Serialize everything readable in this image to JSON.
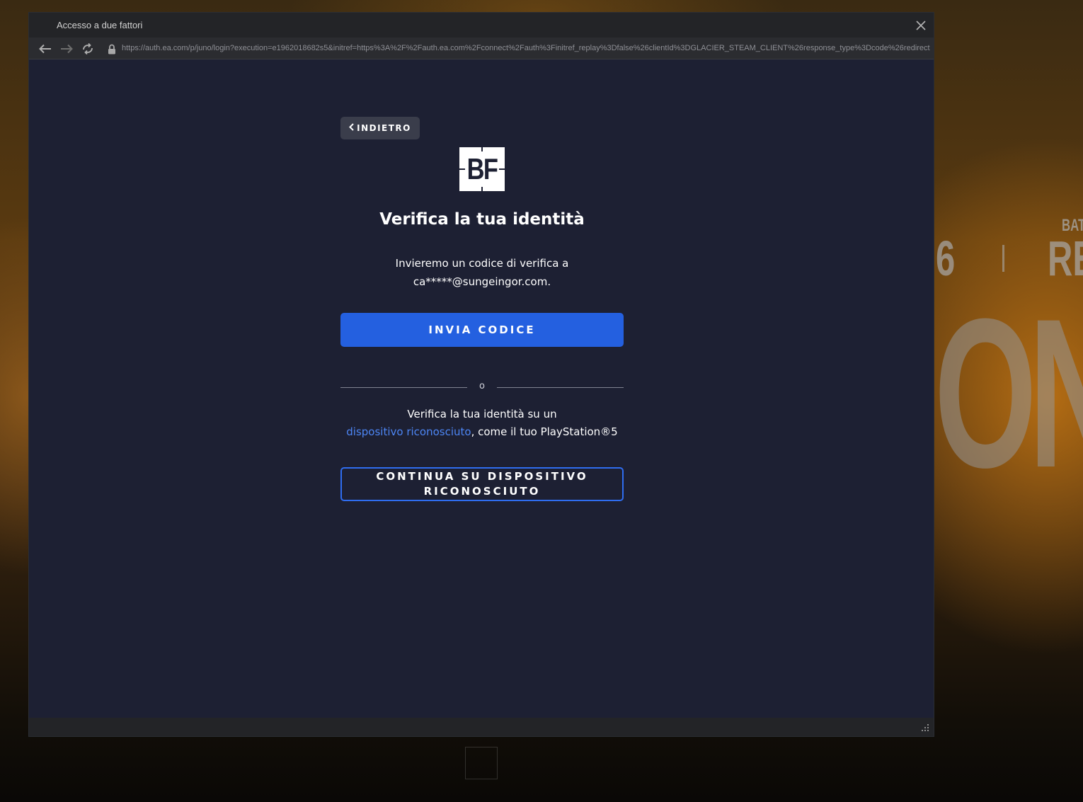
{
  "window": {
    "title": "Accesso a due fattori",
    "url": "https://auth.ea.com/p/juno/login?execution=e1962018682s5&initref=https%3A%2F%2Fauth.ea.com%2Fconnect%2Fauth%3Finitref_replay%3Dfalse%26clientId%3DGLACIER_STEAM_CLIENT%26response_type%3Dcode%26redirect"
  },
  "form": {
    "back_label": "INDIETRO",
    "logo_text": "BF",
    "heading": "Verifica la tua identità",
    "desc_line1": "Invieremo un codice di verifica a",
    "desc_line2": "ca*****@sungeingor.com.",
    "send_code_label": "INVIA CODICE",
    "divider_text": "o",
    "alt_line1": "Verifica la tua identità su un",
    "alt_link": "dispositivo riconosciuto",
    "alt_line2_rest": ", come il tuo PlayStation®5",
    "continue_line1": "CONTINUA SU DISPOSITIVO",
    "continue_line2": "RICONOSCIUTO"
  },
  "background": {
    "small_top": "BAT",
    "small_left": "6",
    "small_right": "RE",
    "big_word": "ON"
  },
  "colors": {
    "panel_bg": "#1d2033",
    "primary_button": "#2460e0",
    "link": "#4d86f5",
    "outline_button_border": "#2f6df0"
  }
}
